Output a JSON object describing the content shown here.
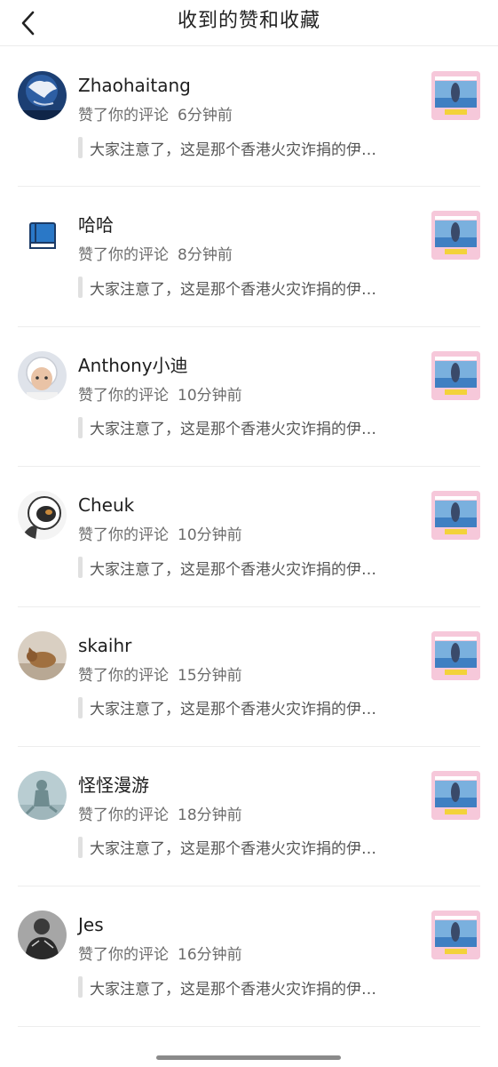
{
  "header": {
    "title": "收到的赞和收藏",
    "back_icon": "chevron-left-icon"
  },
  "items": [
    {
      "username": "Zhaohaitang",
      "action": "赞了你的评论",
      "time": "6分钟前",
      "quote": "大家注意了，这是那个香港火灾诈捐的伊…",
      "avatar": "globe-avatar"
    },
    {
      "username": "哈哈",
      "action": "赞了你的评论",
      "time": "8分钟前",
      "quote": "大家注意了，这是那个香港火灾诈捐的伊…",
      "avatar": "book-avatar"
    },
    {
      "username": "Anthony小迪",
      "action": "赞了你的评论",
      "time": "10分钟前",
      "quote": "大家注意了，这是那个香港火灾诈捐的伊…",
      "avatar": "child-avatar"
    },
    {
      "username": "Cheuk",
      "action": "赞了你的评论",
      "time": "10分钟前",
      "quote": "大家注意了，这是那个香港火灾诈捐的伊…",
      "avatar": "astronaut-avatar"
    },
    {
      "username": "skaihr",
      "action": "赞了你的评论",
      "time": "15分钟前",
      "quote": "大家注意了，这是那个香港火灾诈捐的伊…",
      "avatar": "cat-avatar"
    },
    {
      "username": "怪怪漫游",
      "action": "赞了你的评论",
      "time": "18分钟前",
      "quote": "大家注意了，这是那个香港火灾诈捐的伊…",
      "avatar": "statue-avatar"
    },
    {
      "username": "Jes",
      "action": "赞了你的评论",
      "time": "16分钟前",
      "quote": "大家注意了，这是那个香港火灾诈捐的伊…",
      "avatar": "person-avatar"
    }
  ],
  "colors": {
    "accent_thumb": "#f6c8da",
    "divider": "#ededed",
    "secondary_text": "#6b6b6b"
  }
}
